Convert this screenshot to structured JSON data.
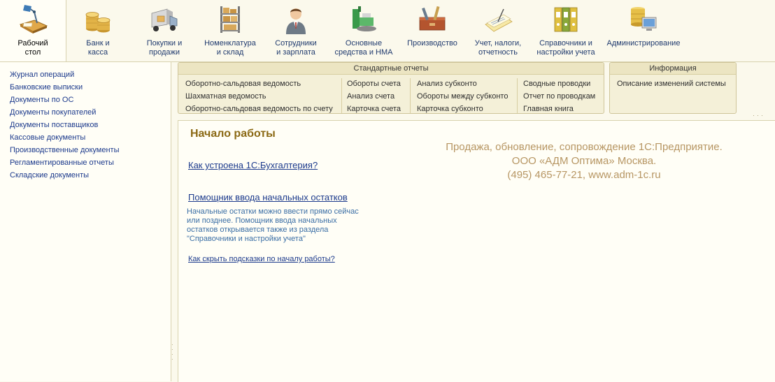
{
  "toolbar": {
    "sections": [
      {
        "label": "Рабочий\nстол",
        "icon": "desk-lamp-icon"
      },
      {
        "label": "Банк и\nкасса",
        "icon": "coins-icon"
      },
      {
        "label": "Покупки и\nпродажи",
        "icon": "truck-icon"
      },
      {
        "label": "Номенклатура\nи склад",
        "icon": "warehouse-shelf-icon"
      },
      {
        "label": "Сотрудники\nи зарплата",
        "icon": "employee-icon"
      },
      {
        "label": "Основные\nсредства и НМА",
        "icon": "equipment-icon"
      },
      {
        "label": "Производство",
        "icon": "toolbox-icon"
      },
      {
        "label": "Учет, налоги,\nотчетность",
        "icon": "notebook-icon"
      },
      {
        "label": "Справочники и\nнастройки учета",
        "icon": "binders-icon"
      },
      {
        "label": "Администрирование",
        "icon": "admin-computer-icon"
      }
    ]
  },
  "nav": {
    "items": [
      "Журнал операций",
      "Банковские выписки",
      "Документы по ОС",
      "Документы покупателей",
      "Документы поставщиков",
      "Кассовые документы",
      "Производственные документы",
      "Регламентированные отчеты",
      "Складские документы"
    ]
  },
  "standard_reports": {
    "title": "Стандартные отчеты",
    "columns": [
      [
        "Оборотно-сальдовая ведомость",
        "Шахматная ведомость",
        "Оборотно-сальдовая ведомость по счету"
      ],
      [
        "Обороты счета",
        "Анализ счета",
        "Карточка счета"
      ],
      [
        "Анализ субконто",
        "Обороты между субконто",
        "Карточка субконто"
      ],
      [
        "Сводные проводки",
        "Отчет по проводкам",
        "Главная книга"
      ]
    ]
  },
  "info": {
    "title": "Информация",
    "items": [
      "Описание изменений системы"
    ]
  },
  "main": {
    "title": "Начало работы",
    "link1": "Как устроена 1С:Бухгалтерия?",
    "link2": "Помощник ввода начальных остатков",
    "desc": "Начальные остатки можно ввести прямо сейчас или позднее. Помощник ввода начальных остатков открывается также из раздела \"Справочники и настройки учета\"",
    "link3": "Как скрыть подсказки по началу работы?",
    "ad_line1": "Продажа, обновление, сопровождение 1С:Предприятие.",
    "ad_line2": "ООО «АДМ Оптима» Москва.",
    "ad_line3": "(495) 465-77-21, www.adm-1c.ru"
  },
  "colors": {
    "background": "#fbf9ec",
    "link": "#1c3a8c",
    "title": "#8b6914",
    "ad_text": "#b79663"
  }
}
